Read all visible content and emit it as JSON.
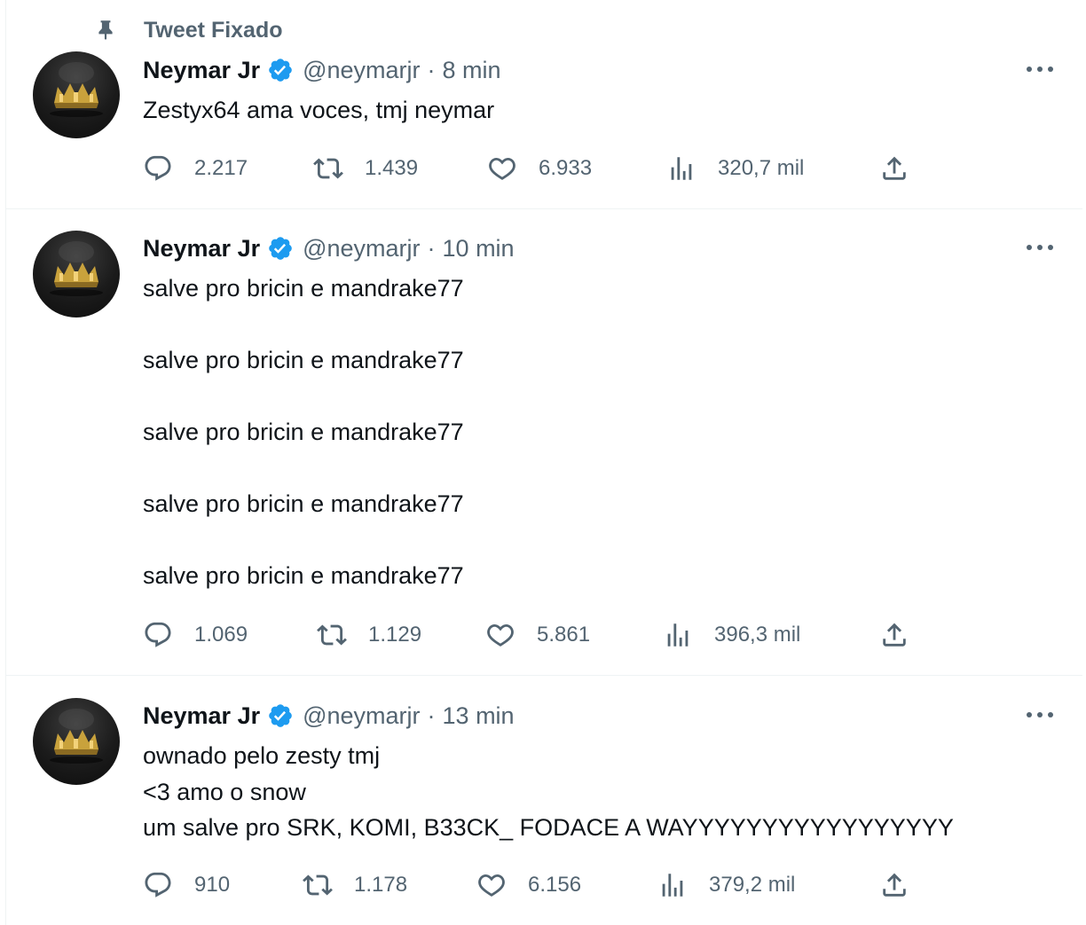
{
  "pinned_label": "Tweet Fixado",
  "colors": {
    "verified": "#1d9bf0",
    "muted": "#536471",
    "text": "#0f1419",
    "crown": "#c9a23c"
  },
  "tweets": [
    {
      "name": "Neymar Jr",
      "handle": "@neymarjr",
      "separator": "·",
      "time": "8 min",
      "text": "Zestyx64 ama voces, tmj neymar",
      "replies": "2.217",
      "retweets": "1.439",
      "likes": "6.933",
      "views": "320,7 mil"
    },
    {
      "name": "Neymar Jr",
      "handle": "@neymarjr",
      "separator": "·",
      "time": "10 min",
      "text": "salve pro bricin e mandrake77\n\nsalve pro bricin e mandrake77\n\nsalve pro bricin e mandrake77\n\nsalve pro bricin e mandrake77\n\nsalve pro bricin e mandrake77",
      "replies": "1.069",
      "retweets": "1.129",
      "likes": "5.861",
      "views": "396,3 mil"
    },
    {
      "name": "Neymar Jr",
      "handle": "@neymarjr",
      "separator": "·",
      "time": "13 min",
      "text": "ownado pelo zesty tmj\n<3 amo o snow\num salve pro SRK, KOMI, B33CK_ FODACE A WAYYYYYYYYYYYYYYYYY",
      "replies": "910",
      "retweets": "1.178",
      "likes": "6.156",
      "views": "379,2 mil"
    }
  ]
}
